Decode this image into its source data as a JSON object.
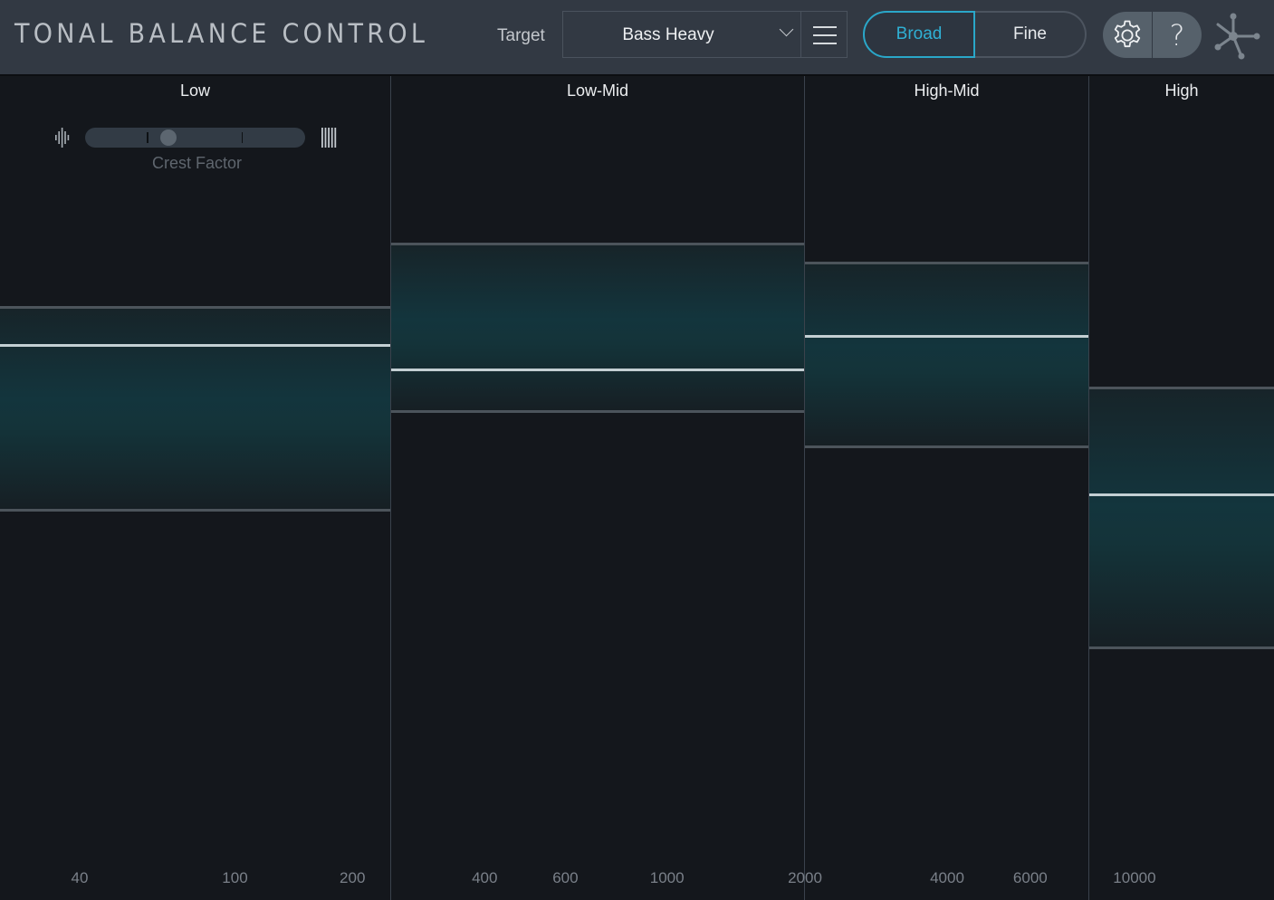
{
  "header": {
    "app_title": "TONAL BALANCE CONTROL",
    "target_label": "Target",
    "preset": "Bass Heavy",
    "view_modes": [
      {
        "label": "Broad",
        "active": true
      },
      {
        "label": "Fine",
        "active": false
      }
    ],
    "help_label": "?",
    "accent_color": "#2aa7c9"
  },
  "crest_factor": {
    "label": "Crest Factor",
    "value": 0.38,
    "ticks": [
      0.28,
      0.71
    ]
  },
  "level_scale_note": "levels are normalized 0 (bottom) to 1 (top) of meter",
  "bands": [
    {
      "name": "Low",
      "freq_range": [
        25,
        250
      ],
      "target_top": 0.72,
      "target_bottom": 0.474,
      "level": 0.674,
      "ticks": [
        "40",
        "100",
        "200"
      ]
    },
    {
      "name": "Low-Mid",
      "freq_range": [
        250,
        2000
      ],
      "target_top": 0.797,
      "target_bottom": 0.593,
      "level": 0.644,
      "ticks": [
        "400",
        "600",
        "1000",
        "2000"
      ]
    },
    {
      "name": "High-Mid",
      "freq_range": [
        2000,
        8000
      ],
      "target_top": 0.774,
      "target_bottom": 0.551,
      "level": 0.685,
      "ticks": [
        "4000",
        "6000"
      ]
    },
    {
      "name": "High",
      "freq_range": [
        8000,
        20000
      ],
      "target_top": 0.622,
      "target_bottom": 0.307,
      "level": 0.492,
      "ticks": [
        "10000"
      ]
    }
  ]
}
